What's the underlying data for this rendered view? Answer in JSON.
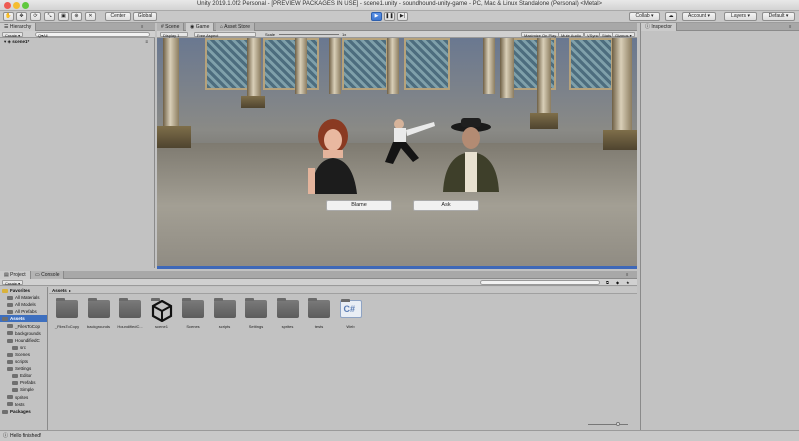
{
  "window": {
    "title": "Unity 2019.1.0f2 Personal - [PREVIEW PACKAGES IN USE] - scene1.unity - soundhound-unity-game - PC, Mac & Linux Standalone (Personal) <Metal>"
  },
  "toolbar": {
    "center_label": "Center",
    "global_label": "Global",
    "collab_label": "Collab ▾",
    "account_label": "Account ▾",
    "layers_label": "Layers ▾",
    "layout_label": "Default ▾"
  },
  "hierarchy": {
    "tab_label": "Hierarchy",
    "create_label": "Create ▾",
    "search_placeholder": "Q▾All",
    "scene_name": "scene1*"
  },
  "center_tabs": {
    "scene": "Scene",
    "game": "Game",
    "asset_store": "Asset Store"
  },
  "game_bar": {
    "display": "Display 1",
    "aspect": "Free Aspect",
    "scale_label": "Scale",
    "scale_value": "1x",
    "maximize": "Maximize On Play",
    "mute": "Mute Audio",
    "vsync": "VSync",
    "stats": "Stats",
    "gizmos": "Gizmos ▾"
  },
  "game_buttons": {
    "blame": "Blame",
    "ask": "Ask"
  },
  "inspector": {
    "tab_label": "Inspector"
  },
  "project": {
    "tab_project": "Project",
    "tab_console": "Console",
    "create_label": "Create ▾",
    "breadcrumb": "Assets",
    "tree": [
      {
        "label": "Favorites",
        "indent": 0,
        "yellow": true
      },
      {
        "label": "All Materials",
        "indent": 1,
        "yellow": false
      },
      {
        "label": "All Models",
        "indent": 1,
        "yellow": false
      },
      {
        "label": "All Prefabs",
        "indent": 1,
        "yellow": false
      },
      {
        "label": "Assets",
        "indent": 0,
        "yellow": false,
        "selected": true
      },
      {
        "label": "_FilesToCop",
        "indent": 1,
        "yellow": false
      },
      {
        "label": "backgrounds",
        "indent": 1,
        "yellow": false
      },
      {
        "label": "HoundifiedC",
        "indent": 1,
        "yellow": false
      },
      {
        "label": "src",
        "indent": 2,
        "yellow": false
      },
      {
        "label": "Scenes",
        "indent": 1,
        "yellow": false
      },
      {
        "label": "scripts",
        "indent": 1,
        "yellow": false
      },
      {
        "label": "Settings",
        "indent": 1,
        "yellow": false
      },
      {
        "label": "Editor",
        "indent": 2,
        "yellow": false
      },
      {
        "label": "Prefabs",
        "indent": 2,
        "yellow": false
      },
      {
        "label": "Simple",
        "indent": 2,
        "yellow": false
      },
      {
        "label": "sprites",
        "indent": 1,
        "yellow": false
      },
      {
        "label": "tests",
        "indent": 1,
        "yellow": false
      },
      {
        "label": "Packages",
        "indent": 0,
        "yellow": false
      }
    ],
    "assets": [
      {
        "label": "_FilesToCopy",
        "kind": "folder"
      },
      {
        "label": "backgrounds",
        "kind": "folder"
      },
      {
        "label": "HoundifiedC...",
        "kind": "folder"
      },
      {
        "label": "scene1",
        "kind": "unity"
      },
      {
        "label": "Scenes",
        "kind": "folder"
      },
      {
        "label": "scripts",
        "kind": "folder"
      },
      {
        "label": "Settings",
        "kind": "folder"
      },
      {
        "label": "sprites",
        "kind": "folder"
      },
      {
        "label": "tests",
        "kind": "folder"
      },
      {
        "label": "Web",
        "kind": "cs"
      }
    ]
  },
  "status": {
    "text": "Hello finished!"
  },
  "colors": {
    "accent": "#3e77d1",
    "panel": "#c2c2c2",
    "selection": "#3d6fbf"
  }
}
